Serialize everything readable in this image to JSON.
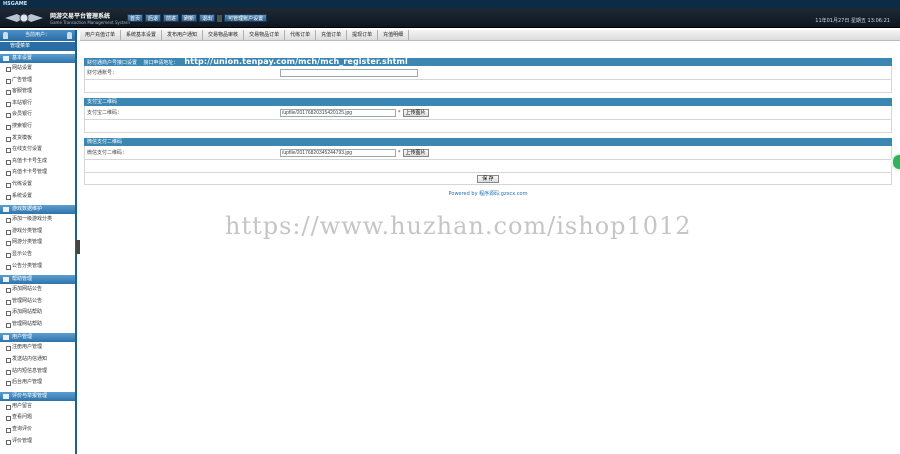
{
  "topbar": {
    "title": "HSGAME"
  },
  "header": {
    "brand_title": "网游交易平台管理系统",
    "brand_subtitle": "Game Transaction Management System",
    "toolbar": [
      "首页",
      "后退",
      "前进",
      "刷新",
      "退出",
      "可管理账户设置"
    ],
    "datetime": "11年01月27日 星期五 13:06:21"
  },
  "tabs": [
    "用户充值订单",
    "系统基本设置",
    "发布用户通知",
    "交易物品审核",
    "交易物品订单",
    "代练订单",
    "充值订单",
    "提现订单",
    "充值明细"
  ],
  "sidebar": {
    "top_label": "当前用户：",
    "title": "管理菜单",
    "groups": [
      {
        "title": "基本设置",
        "items": [
          "网站设置",
          "广告管理",
          "客服管理",
          "本站银行",
          "会员银行",
          "搜索银行",
          "发货模板",
          "在线支付设置",
          "充值卡卡号生成",
          "充值卡卡号管理",
          "代练设置",
          "系统设置"
        ]
      },
      {
        "title": "游戏数据维护",
        "items": [
          "添加一级游戏分类",
          "游戏分类管理",
          "网游分类管理",
          "显示公告",
          "公告分类管理"
        ]
      },
      {
        "title": "帮助管理",
        "items": [
          "添加网站公告",
          "管理网站公告",
          "添加网站帮助",
          "管理网站帮助"
        ]
      },
      {
        "title": "用户管理",
        "items": [
          "注册用户管理",
          "发送站内信通知",
          "站内短信息管理",
          "后台用户管理"
        ]
      },
      {
        "title": "评价与举报管理",
        "items": [
          "用户留言",
          "查看问题",
          "查询评价",
          "评价管理"
        ]
      }
    ]
  },
  "main": {
    "section1": {
      "title": "财付通商户号接口设置",
      "url_label": "接口申请地址：",
      "url": "http://union.tenpay.com/mch/mch_register.shtml",
      "field_label": "财付通账号：",
      "field_value": ""
    },
    "section2": {
      "title": "支付宝二维码",
      "field_label": "支付宝二维码：",
      "field_value": "/upfile/20176820315420125.jpg",
      "upload_label": "上传图片"
    },
    "section3": {
      "title": "微信支付二维码",
      "field_label": "微信支付二维码：",
      "field_value": "/upfile/20176820345244793.jpg",
      "upload_label": "上传图片"
    },
    "required_mark": "*",
    "submit_label": "保 存",
    "footer": "Powered by 程序源码:gzxcx.com"
  },
  "watermark": "https://www.huzhan.com/ishop1012"
}
